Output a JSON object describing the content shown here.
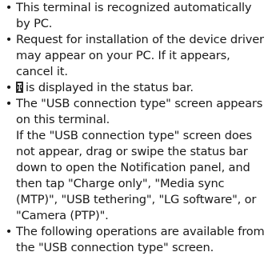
{
  "bullets": [
    {
      "text": "This terminal is recognized automatically by PC."
    },
    {
      "text": "Request for installation of the device driver may appear on your PC. If it appears, cancel it."
    },
    {
      "icon": "usb-status-icon",
      "text": "is displayed in the status bar."
    },
    {
      "text": "The \"USB connection type\" screen appears on this terminal.",
      "note": "If the \"USB connection type\" screen does not appear, drag or swipe the status bar down to open the Notification panel, and then tap \"Charge only\", \"Media sync (MTP)\", \"USB tethering\", \"LG software\", or \"Camera (PTP)\"."
    },
    {
      "text": "The following operations are available from the \"USB connection type\" screen."
    }
  ],
  "bullet_symbol": "•"
}
